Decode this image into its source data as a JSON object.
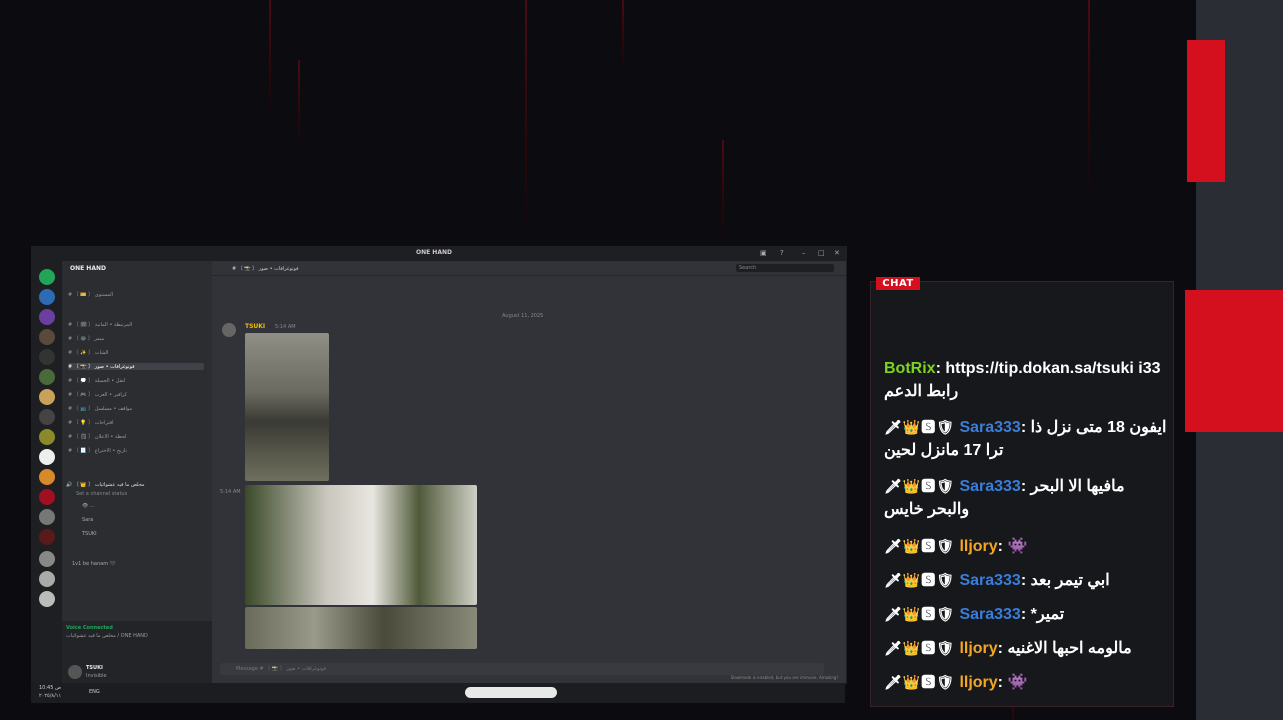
{
  "window": {
    "title": "ONE HAND"
  },
  "server": {
    "name": "ONE HAND"
  },
  "channels": [
    "# 〘 🎫 〙 المستوى",
    "# 〘 🗓 〙 المرتبطة • المانية",
    "# 〘 😂 〙 ميمز",
    "# 〘 ✨ 〙 الشات",
    "# 〘 📸 〙 فوتوغرافات • صور",
    "# 〘 💭 〙 لنقل • الجميلة",
    "# 〘 🎮 〙 كرافير • العزب",
    "# 〘 📺 〙 مواقف • مسلسل",
    "# 〘 💡 〙 اقتراحات",
    "# 〘 🗒 〙 لحظة • الاعلان",
    "# 〘 📃 〙 تاريخ • الاختراع"
  ],
  "voice": {
    "channel": "🔊 〘 👑 〙 مخلص ما فيه عشوائيات",
    "status": "Set a channel status",
    "members": [
      "👁 ...",
      "Sara",
      "TSUKI"
    ],
    "extra": [
      "1v1 be hanam 🖤"
    ],
    "connected_label": "Voice Connected",
    "connected_sub": "مخلص ما فيه عشوائيات / ONE HAND",
    "user": "TSUKI",
    "user_status": "Invisible"
  },
  "main": {
    "channel_name": "# 〘 📸 〙 فوتوغرافات • صور",
    "search_placeholder": "Search",
    "date_divider": "August 11, 2025",
    "author": "TSUKI",
    "time": "5:14 AM",
    "time2": "5:14 AM",
    "composer_placeholder": "Message # 〘 📸 〙 فوتوغرافات • صور",
    "slowmode": "Slowmode is enabled, but you are immune. Amazing!"
  },
  "taskbar": {
    "lang": "ENG",
    "time": "10:45 ص",
    "date": "٢٠٢٥/٨/١١"
  },
  "chat": {
    "header": "CHAT",
    "messages": [
      {
        "user": "BotRix",
        "badges": "",
        "text": "https://tip.dokan.sa/tsuki i33 رابط الدعم",
        "color": "#7ed321"
      },
      {
        "user": "Sara333",
        "badges": "🗡👑🆂🛡",
        "text": "ايفون 18 متى نزل ذا ترا 17 مانزل لحين",
        "color": "#3b7dd8"
      },
      {
        "user": "Sara333",
        "badges": "🗡👑🆂🛡",
        "text": "مافيها الا البحر والبحر خايس",
        "color": "#3b7dd8"
      },
      {
        "user": "lljory",
        "badges": "🗡👑🆂🛡",
        "text": "👾",
        "color": "#f5a623"
      },
      {
        "user": "Sara333",
        "badges": "🗡👑🆂🛡",
        "text": "ابي تيمر بعد",
        "color": "#3b7dd8"
      },
      {
        "user": "Sara333",
        "badges": "🗡👑🆂🛡",
        "text": "تمير*",
        "color": "#3b7dd8"
      },
      {
        "user": "lljory",
        "badges": "🗡👑🆂🛡",
        "text": "مالومه احبها الاغنيه",
        "color": "#f5a623"
      },
      {
        "user": "lljory",
        "badges": "🗡👑🆂🛡",
        "text": "👾",
        "color": "#f5a623"
      }
    ]
  }
}
